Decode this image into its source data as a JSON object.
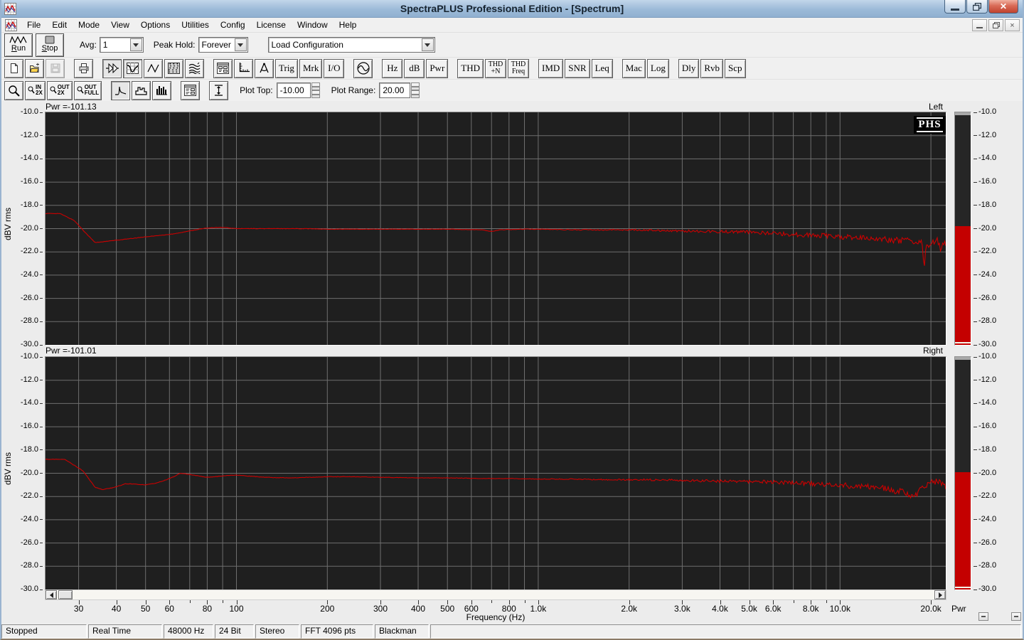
{
  "window": {
    "title": "SpectraPLUS Professional Edition - [Spectrum]"
  },
  "menu": {
    "items": [
      "File",
      "Edit",
      "Mode",
      "View",
      "Options",
      "Utilities",
      "Config",
      "License",
      "Window",
      "Help"
    ]
  },
  "transport": {
    "run_key": "R",
    "run_rest": "un",
    "stop_key": "S",
    "stop_rest": "top",
    "avg_label": "Avg:",
    "avg_value": "1",
    "peak_hold_label": "Peak Hold:",
    "peak_hold_value": "Forever",
    "load_config_value": "Load Configuration"
  },
  "toolbar_text": {
    "trig": "Trig",
    "mrk": "Mrk",
    "io": "I/O",
    "hz": "Hz",
    "db": "dB",
    "pwr": "Pwr",
    "thd": "THD",
    "thdn_1": "THD",
    "thdn_2": "+N",
    "thdfreq_1": "THD",
    "thdfreq_2": "Freq",
    "imd": "IMD",
    "snr": "SNR",
    "leq": "Leq",
    "mac": "Mac",
    "log": "Log",
    "dly": "Dly",
    "rvb": "Rvb",
    "scp": "Scp"
  },
  "toolbar3": {
    "zoom_in_l1": "IN",
    "zoom_in_l2": "2X",
    "zoom_out_l1": "OUT",
    "zoom_out_l2": "2X",
    "zoom_full_l1": "OUT",
    "zoom_full_l2": "FULL",
    "plot_top_label": "Plot Top:",
    "plot_top_value": "-10.00",
    "plot_range_label": "Plot Range:",
    "plot_range_value": "20.00"
  },
  "panes": {
    "logo": "PHS",
    "ylabel": "dBV rms",
    "left_header": "Pwr =-101.13",
    "left_channel": "Left",
    "right_header": "Pwr =-101.01",
    "right_channel": "Right",
    "pwr_axis_label": "Pwr"
  },
  "statusbar": {
    "panels": [
      "Stopped",
      "Real Time",
      "48000 Hz",
      "24 Bit",
      "Stereo",
      "FFT 4096 pts",
      "Blackman",
      ""
    ]
  },
  "chart_data": {
    "type": "line",
    "xscale": "log",
    "xlabel": "Frequency (Hz)",
    "ylabel": "dBV rms",
    "x_range_hz": [
      23.3,
      22400
    ],
    "y_range_db": [
      -30,
      -10
    ],
    "grid": true,
    "bg_color": "#1f1f1f",
    "grid_color": "#6f6f6f",
    "trace_color": "#cc0000",
    "meter_red": "#c40000",
    "y_ticks": [
      -10,
      -12,
      -14,
      -16,
      -18,
      -20,
      -22,
      -24,
      -26,
      -28,
      -30
    ],
    "y_tick_labels": [
      "-10.0",
      "-12.0",
      "-14.0",
      "-16.0",
      "-18.0",
      "-20.0",
      "-22.0",
      "-24.0",
      "-26.0",
      "-28.0",
      "-30.0"
    ],
    "x_ticks": [
      {
        "hz": 30,
        "label": "30"
      },
      {
        "hz": 40,
        "label": "40"
      },
      {
        "hz": 50,
        "label": "50"
      },
      {
        "hz": 60,
        "label": "60"
      },
      {
        "hz": 80,
        "label": "80"
      },
      {
        "hz": 100,
        "label": "100"
      },
      {
        "hz": 200,
        "label": "200"
      },
      {
        "hz": 300,
        "label": "300"
      },
      {
        "hz": 400,
        "label": "400"
      },
      {
        "hz": 500,
        "label": "500"
      },
      {
        "hz": 600,
        "label": "600"
      },
      {
        "hz": 800,
        "label": "800"
      },
      {
        "hz": 1000,
        "label": "1.0k"
      },
      {
        "hz": 2000,
        "label": "2.0k"
      },
      {
        "hz": 3000,
        "label": "3.0k"
      },
      {
        "hz": 4000,
        "label": "4.0k"
      },
      {
        "hz": 5000,
        "label": "5.0k"
      },
      {
        "hz": 6000,
        "label": "6.0k"
      },
      {
        "hz": 8000,
        "label": "8.0k"
      },
      {
        "hz": 10000,
        "label": "10.0k"
      },
      {
        "hz": 20000,
        "label": "20.0k"
      }
    ],
    "noise": {
      "start_hz": 700,
      "max_amp_db": 0.3
    },
    "series": [
      {
        "name": "Left",
        "power_db": -101.13,
        "meter_level_db": -19.8,
        "points": [
          [
            23,
            -18.7
          ],
          [
            26,
            -18.7
          ],
          [
            29,
            -19.3
          ],
          [
            32,
            -20.5
          ],
          [
            34,
            -21.2
          ],
          [
            37,
            -21.1
          ],
          [
            40,
            -21.0
          ],
          [
            45,
            -20.85
          ],
          [
            50,
            -20.7
          ],
          [
            55,
            -20.6
          ],
          [
            60,
            -20.5
          ],
          [
            65,
            -20.35
          ],
          [
            70,
            -20.2
          ],
          [
            75,
            -20.05
          ],
          [
            80,
            -19.95
          ],
          [
            85,
            -19.9
          ],
          [
            90,
            -19.9
          ],
          [
            100,
            -20.0
          ],
          [
            115,
            -20.0
          ],
          [
            140,
            -20.0
          ],
          [
            170,
            -20.0
          ],
          [
            200,
            -20.05
          ],
          [
            250,
            -20.05
          ],
          [
            300,
            -20.05
          ],
          [
            400,
            -20.05
          ],
          [
            500,
            -20.05
          ],
          [
            650,
            -20.1
          ],
          [
            700,
            -20.25
          ],
          [
            750,
            -20.1
          ],
          [
            900,
            -20.05
          ],
          [
            1000,
            -20.05
          ],
          [
            1300,
            -20.1
          ],
          [
            1600,
            -20.1
          ],
          [
            2000,
            -20.1
          ],
          [
            2500,
            -20.15
          ],
          [
            3000,
            -20.2
          ],
          [
            4000,
            -20.25
          ],
          [
            5000,
            -20.3
          ],
          [
            6000,
            -20.4
          ],
          [
            7000,
            -20.5
          ],
          [
            8000,
            -20.55
          ],
          [
            9000,
            -20.6
          ],
          [
            10000,
            -20.7
          ],
          [
            11000,
            -20.75
          ],
          [
            12000,
            -20.8
          ],
          [
            13000,
            -20.85
          ],
          [
            14000,
            -20.9
          ],
          [
            15000,
            -21.0
          ],
          [
            16000,
            -21.0
          ],
          [
            17000,
            -21.1
          ],
          [
            18000,
            -21.15
          ],
          [
            18700,
            -21.2
          ],
          [
            19000,
            -23.6
          ],
          [
            19300,
            -21.4
          ],
          [
            20000,
            -21.3
          ],
          [
            21000,
            -21.0
          ],
          [
            21600,
            -21.9
          ],
          [
            21900,
            -21.1
          ],
          [
            22300,
            -21.3
          ]
        ]
      },
      {
        "name": "Right",
        "power_db": -101.01,
        "meter_level_db": -19.9,
        "points": [
          [
            23,
            -18.8
          ],
          [
            27,
            -18.8
          ],
          [
            31,
            -19.8
          ],
          [
            34,
            -21.2
          ],
          [
            36,
            -21.4
          ],
          [
            39,
            -21.25
          ],
          [
            43,
            -20.9
          ],
          [
            47,
            -20.95
          ],
          [
            50,
            -21.0
          ],
          [
            54,
            -20.85
          ],
          [
            58,
            -20.6
          ],
          [
            62,
            -20.3
          ],
          [
            65,
            -20.0
          ],
          [
            68,
            -20.05
          ],
          [
            72,
            -20.15
          ],
          [
            79,
            -20.35
          ],
          [
            85,
            -20.3
          ],
          [
            92,
            -20.2
          ],
          [
            100,
            -20.15
          ],
          [
            110,
            -20.25
          ],
          [
            125,
            -20.35
          ],
          [
            150,
            -20.4
          ],
          [
            175,
            -20.35
          ],
          [
            200,
            -20.3
          ],
          [
            240,
            -20.3
          ],
          [
            300,
            -20.35
          ],
          [
            400,
            -20.4
          ],
          [
            500,
            -20.4
          ],
          [
            650,
            -20.45
          ],
          [
            800,
            -20.45
          ],
          [
            1000,
            -20.5
          ],
          [
            1300,
            -20.5
          ],
          [
            1700,
            -20.55
          ],
          [
            2200,
            -20.55
          ],
          [
            2800,
            -20.6
          ],
          [
            3500,
            -20.65
          ],
          [
            4500,
            -20.7
          ],
          [
            5500,
            -20.75
          ],
          [
            6500,
            -20.8
          ],
          [
            8000,
            -20.9
          ],
          [
            9000,
            -21.0
          ],
          [
            10000,
            -21.0
          ],
          [
            11000,
            -21.1
          ],
          [
            12000,
            -21.15
          ],
          [
            13000,
            -21.2
          ],
          [
            14000,
            -21.3
          ],
          [
            15000,
            -21.5
          ],
          [
            16000,
            -21.6
          ],
          [
            16800,
            -21.9
          ],
          [
            17300,
            -22.1
          ],
          [
            17800,
            -21.9
          ],
          [
            18500,
            -21.4
          ],
          [
            19200,
            -21.0
          ],
          [
            20000,
            -20.8
          ],
          [
            20800,
            -20.75
          ],
          [
            21500,
            -20.9
          ],
          [
            22200,
            -21.1
          ]
        ]
      }
    ]
  }
}
